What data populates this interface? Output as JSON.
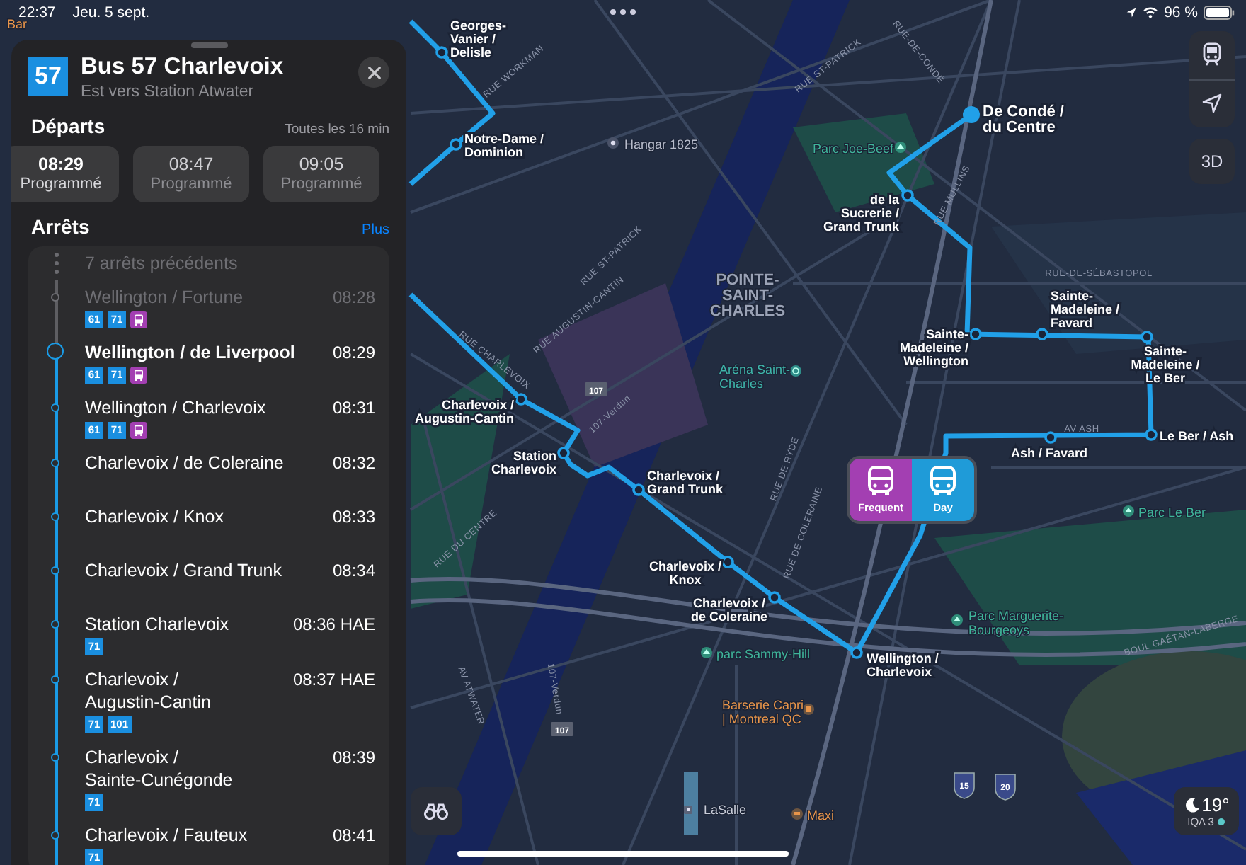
{
  "status_bar": {
    "time": "22:37",
    "date": "Jeu. 5 sept.",
    "battery": "96 %"
  },
  "panel": {
    "route_number": "57",
    "title": "Bus 57 Charlevoix",
    "subtitle": "Est vers Station Atwater",
    "departures_heading": "Départs",
    "frequency": "Toutes les 16 min",
    "departures": [
      {
        "time": "08:29",
        "status": "Programmé",
        "selected": true
      },
      {
        "time": "08:47",
        "status": "Programmé",
        "selected": false
      },
      {
        "time": "09:05",
        "status": "Programmé",
        "selected": false
      }
    ],
    "stops_heading": "Arrêts",
    "more_link": "Plus",
    "previous_stops": "7 arrêts précédents",
    "stops": [
      {
        "name": "Wellington / Fortune",
        "time": "08:28",
        "passed": true,
        "current": false,
        "connections": [
          {
            "kind": "route",
            "label": "61"
          },
          {
            "kind": "route",
            "label": "71"
          },
          {
            "kind": "bus"
          }
        ]
      },
      {
        "name": "Wellington / de Liverpool",
        "time": "08:29",
        "passed": false,
        "current": true,
        "connections": [
          {
            "kind": "route",
            "label": "61"
          },
          {
            "kind": "route",
            "label": "71"
          },
          {
            "kind": "bus"
          }
        ]
      },
      {
        "name": "Wellington / Charlevoix",
        "time": "08:31",
        "passed": false,
        "current": false,
        "connections": [
          {
            "kind": "route",
            "label": "61"
          },
          {
            "kind": "route",
            "label": "71"
          },
          {
            "kind": "bus"
          }
        ]
      },
      {
        "name": "Charlevoix / de Coleraine",
        "time": "08:32",
        "passed": false,
        "current": false
      },
      {
        "name": "Charlevoix / Knox",
        "time": "08:33",
        "passed": false,
        "current": false
      },
      {
        "name": "Charlevoix / Grand Trunk",
        "time": "08:34",
        "passed": false,
        "current": false
      },
      {
        "name": "Station Charlevoix",
        "time": "08:36 HAE",
        "passed": false,
        "current": false,
        "connections": [
          {
            "kind": "route",
            "label": "71"
          }
        ]
      },
      {
        "name": "Charlevoix /\nAugustin-Cantin",
        "time": "08:37 HAE",
        "passed": false,
        "current": false,
        "connections": [
          {
            "kind": "route",
            "label": "71"
          },
          {
            "kind": "route",
            "label": "101"
          }
        ]
      },
      {
        "name": "Charlevoix /\nSainte-Cunégonde",
        "time": "08:39",
        "passed": false,
        "current": false,
        "connections": [
          {
            "kind": "route",
            "label": "71"
          }
        ]
      },
      {
        "name": "Charlevoix / Fauteux",
        "time": "08:41",
        "passed": false,
        "current": false,
        "connections": [
          {
            "kind": "route",
            "label": "71"
          }
        ]
      }
    ]
  },
  "map": {
    "stops": [
      {
        "kind": "stop",
        "lines": [
          "Georges-",
          "Vanier /",
          "Delisle"
        ]
      },
      {
        "kind": "stop",
        "lines": [
          "Notre-Dame /",
          "Dominion"
        ]
      },
      {
        "kind": "terminus",
        "lines": [
          "De Condé /",
          "du Centre"
        ]
      },
      {
        "kind": "stop",
        "lines": [
          "de la",
          "Sucrerie /",
          "Grand Trunk"
        ]
      },
      {
        "kind": "stop",
        "lines": [
          "Sainte-",
          "Madeleine /",
          "Wellington"
        ]
      },
      {
        "kind": "stop",
        "lines": [
          "Sainte-",
          "Madeleine /",
          "Favard"
        ]
      },
      {
        "kind": "stop",
        "lines": [
          "Sainte-",
          "Madeleine /",
          "Le Ber"
        ]
      },
      {
        "kind": "stop",
        "lines": [
          "Le Ber / Ash"
        ]
      },
      {
        "kind": "stop",
        "lines": [
          "Ash / Favard"
        ]
      },
      {
        "kind": "stop",
        "lines": [
          "Charlevoix /",
          "Augustin-Cantin"
        ]
      },
      {
        "kind": "stop",
        "lines": [
          "Station",
          "Charlevoix"
        ]
      },
      {
        "kind": "stop",
        "lines": [
          "Charlevoix /",
          "Grand Trunk"
        ]
      },
      {
        "kind": "stop",
        "lines": [
          "Charlevoix /",
          "Knox"
        ]
      },
      {
        "kind": "stop",
        "lines": [
          "Charlevoix /",
          "de Coleraine"
        ]
      },
      {
        "kind": "stop",
        "lines": [
          "Wellington /",
          "Charlevoix"
        ]
      }
    ],
    "places": [
      {
        "kind": "restaurant",
        "lines": [
          "Bar"
        ]
      },
      {
        "kind": "landmark",
        "lines": [
          "Hangar 1825"
        ]
      },
      {
        "kind": "park",
        "lines": [
          "Parc Joe-Beef"
        ]
      },
      {
        "kind": "district",
        "lines": [
          "POINTE-",
          "SAINT-",
          "CHARLES"
        ]
      },
      {
        "kind": "arena",
        "lines": [
          "Aréna Saint-",
          "Charles"
        ]
      },
      {
        "kind": "park",
        "lines": [
          "Parc Le Ber"
        ]
      },
      {
        "kind": "park",
        "lines": [
          "Parc Marguerite-",
          "Bourgeoys"
        ]
      },
      {
        "kind": "park",
        "lines": [
          "parc Sammy-Hill"
        ]
      },
      {
        "kind": "restaurant",
        "lines": [
          "Barserie Capri",
          "| Montreal QC"
        ]
      },
      {
        "kind": "shop",
        "lines": [
          "Maxi"
        ]
      },
      {
        "kind": "station",
        "lines": [
          "LaSalle"
        ]
      }
    ],
    "streets": [
      "RUE WORKMAN",
      "RUE ST-PATRICK",
      "RUE ST-PATRICK",
      "RUE-DE-CONDÉ",
      "RUE MULLINS",
      "RUE-DE-SÉBASTOPOL",
      "RUE CHARLEVOIX",
      "RUE AUGUSTIN-CANTIN",
      "107-Verdun",
      "RUE DE RYDE",
      "RUE DE COLERAINE",
      "AV ASH",
      "BOUL GAÉTAN-LABERGE",
      "AV ATWATER",
      "107-Verdun",
      "RUE DU CENTRE"
    ],
    "shields": [
      {
        "kind": "regional",
        "label": "107"
      },
      {
        "kind": "regional",
        "label": "107"
      },
      {
        "kind": "highway",
        "label": "15"
      },
      {
        "kind": "highway",
        "label": "20"
      }
    ],
    "legend": [
      {
        "label": "Frequent",
        "color": "#a33fb2"
      },
      {
        "label": "Day",
        "color": "#1f9bd8"
      }
    ],
    "view_button": "3D",
    "weather": {
      "temperature": "19°",
      "aqi": "IQA 3",
      "aqi_good": true
    }
  }
}
